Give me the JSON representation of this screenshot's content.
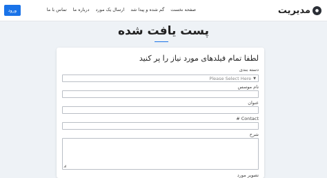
{
  "navbar": {
    "brand_name": "مدیریت",
    "brand_logo": "logo-icon",
    "links": [
      "صفحه نخست",
      "گم شده و پیدا شد",
      "ارسال یک مورد",
      "درباره ما",
      "تماس با ما"
    ],
    "login_label": "ورود",
    "accent_color": "#1a73e8"
  },
  "page": {
    "title": "پست یافت شده"
  },
  "form": {
    "heading": "لطفا تمام فیلدهای مورد نیاز را پر کنید",
    "category_label": "دسته بندی",
    "category_placeholder": "Please Select Here",
    "name_label": "نام موسس",
    "title_label": "عنوان",
    "contact_label": "Contact #",
    "description_label": "شرح",
    "image_label": "تصویر مورد"
  }
}
